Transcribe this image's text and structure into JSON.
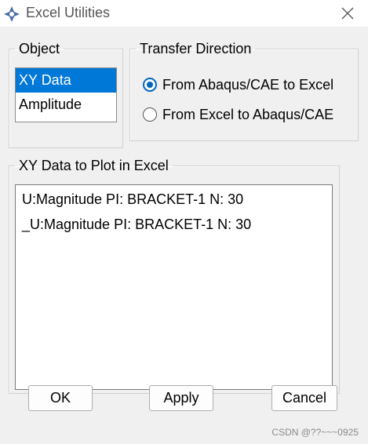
{
  "window": {
    "title": "Excel Utilities",
    "app_icon": "abaqus-compass-icon",
    "close_icon": "close-icon"
  },
  "object_group": {
    "legend": "Object",
    "items": [
      {
        "label": "XY Data",
        "selected": true
      },
      {
        "label": "Amplitude",
        "selected": false
      }
    ]
  },
  "transfer_group": {
    "legend": "Transfer Direction",
    "options": [
      {
        "label": "From Abaqus/CAE to Excel",
        "checked": true
      },
      {
        "label": "From Excel to Abaqus/CAE",
        "checked": false
      }
    ]
  },
  "xy_group": {
    "legend": "XY Data to Plot in Excel",
    "items": [
      "U:Magnitude PI: BRACKET-1 N: 30",
      "_U:Magnitude PI: BRACKET-1 N: 30"
    ]
  },
  "buttons": {
    "ok": "OK",
    "apply": "Apply",
    "cancel": "Cancel"
  },
  "watermark": "CSDN @??~~~0925",
  "colors": {
    "selection": "#0078d7",
    "radio": "#0067c0"
  }
}
